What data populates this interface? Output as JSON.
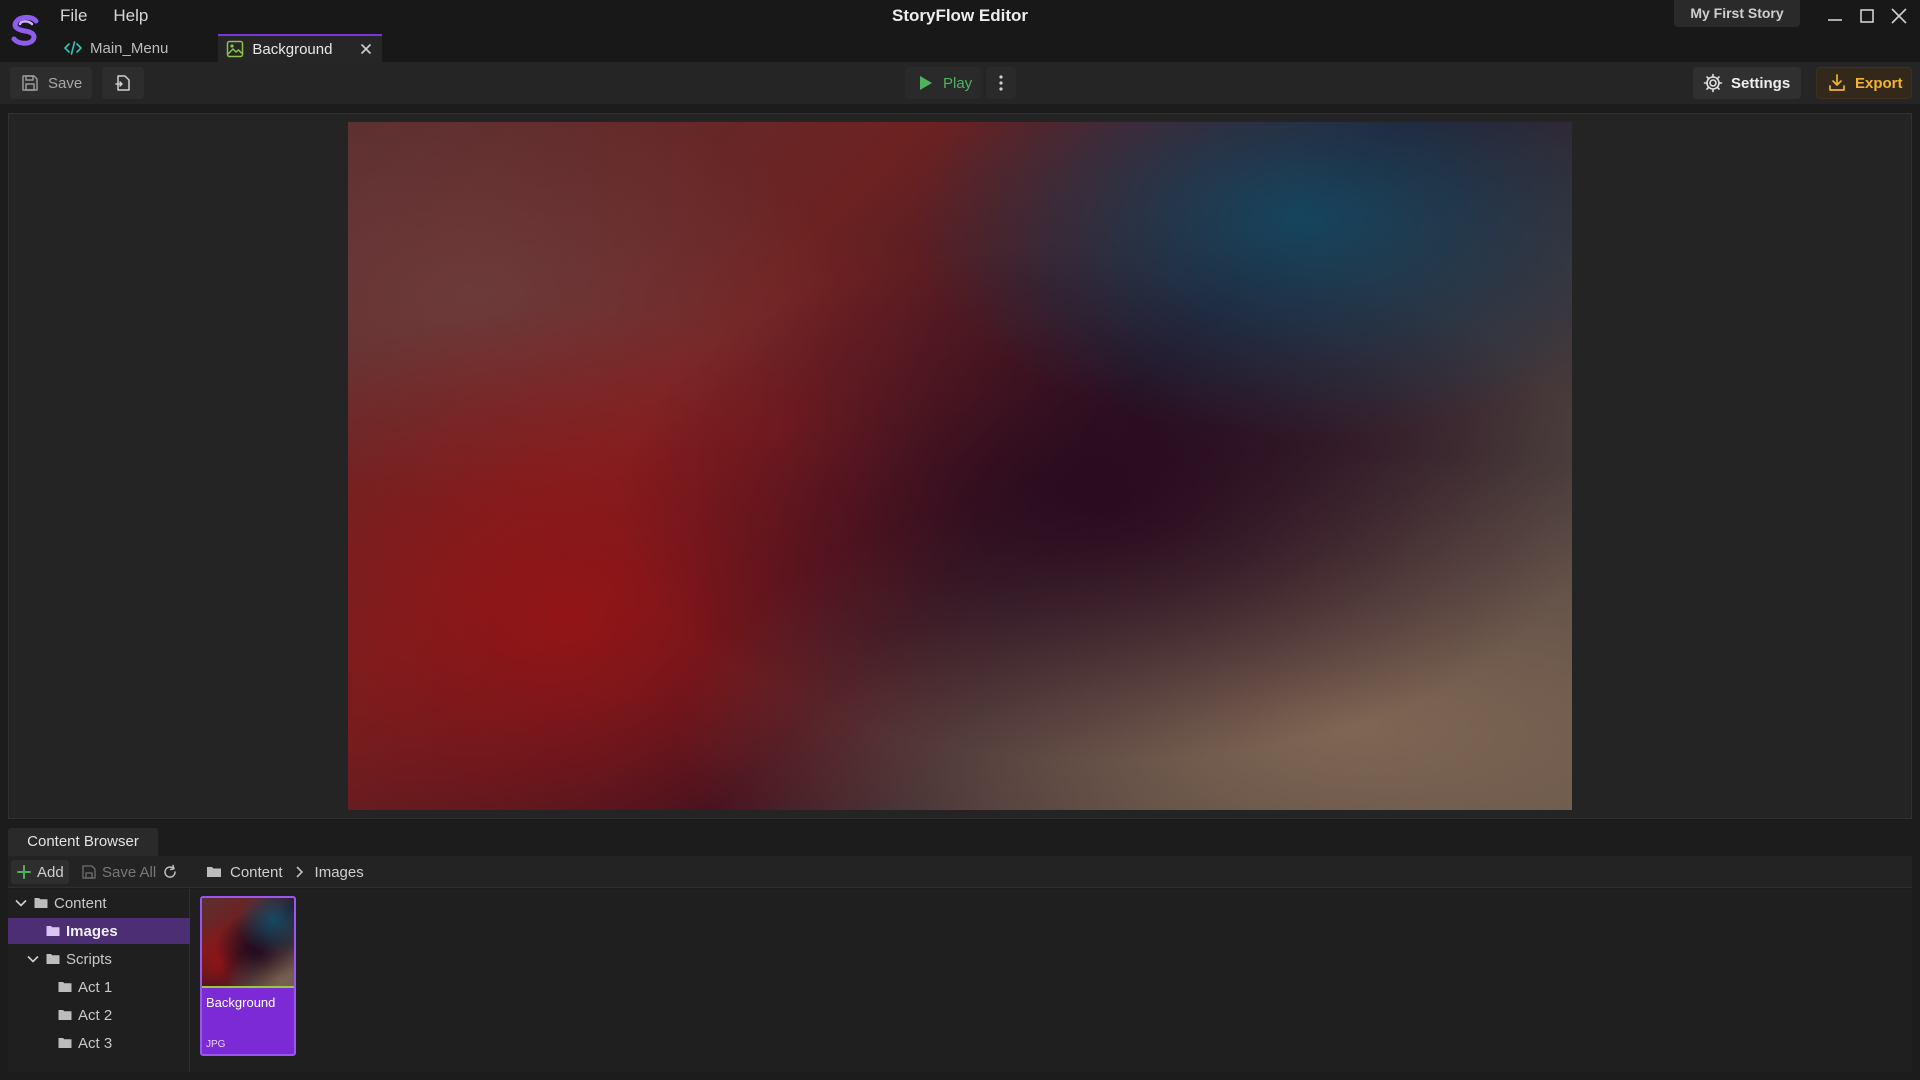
{
  "app": {
    "title": "StoryFlow Editor",
    "project": "My First Story",
    "menu": [
      {
        "label": "File"
      },
      {
        "label": "Help"
      }
    ],
    "accent_color": "#7c2ad6"
  },
  "tabs": [
    {
      "label": "Main_Menu",
      "icon": "code-icon",
      "active": false
    },
    {
      "label": "Background",
      "icon": "image-icon",
      "active": true
    }
  ],
  "toolbar": {
    "save_label": "Save",
    "play_label": "Play",
    "settings_label": "Settings",
    "export_label": "Export",
    "play_color": "#4fb35e",
    "export_color": "#f2b233"
  },
  "content_browser": {
    "tab_label": "Content Browser",
    "add_label": "Add",
    "save_all_label": "Save All",
    "breadcrumb": [
      "Content",
      "Images"
    ],
    "tree": [
      {
        "label": "Content",
        "depth": 0,
        "expandable": true,
        "selected": false
      },
      {
        "label": "Images",
        "depth": 1,
        "expandable": false,
        "selected": true
      },
      {
        "label": "Scripts",
        "depth": 1,
        "expandable": true,
        "selected": false
      },
      {
        "label": "Act 1",
        "depth": 2,
        "expandable": false,
        "selected": false
      },
      {
        "label": "Act 2",
        "depth": 2,
        "expandable": false,
        "selected": false
      },
      {
        "label": "Act 3",
        "depth": 2,
        "expandable": false,
        "selected": false
      }
    ],
    "assets": [
      {
        "name": "Background",
        "type": "JPG"
      }
    ]
  }
}
